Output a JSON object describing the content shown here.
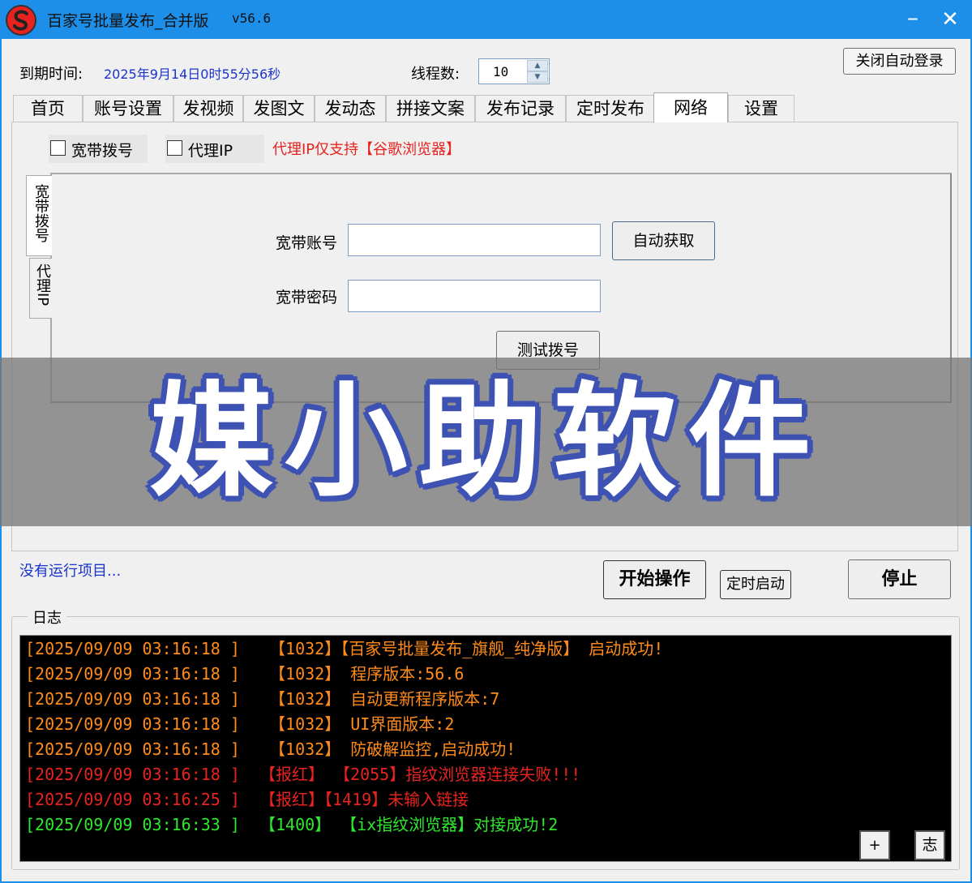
{
  "window": {
    "title": "百家号批量发布_合并版",
    "version": "v56.6",
    "minimize_label": "–",
    "close_label": "✕",
    "logo_icon": "red-s-logo-icon"
  },
  "header": {
    "expiry_label": "到期时间:",
    "expiry_value": "2025年9月14日0时55分56秒",
    "thread_label": "线程数:",
    "thread_value": "10",
    "spin_up": "▲",
    "spin_down": "▼",
    "close_autologin_label": "关闭自动登录"
  },
  "tabs": [
    "首页",
    "账号设置",
    "发视频",
    "发图文",
    "发动态",
    "拼接文案",
    "发布记录",
    "定时发布",
    "网络",
    "设置"
  ],
  "active_tab": "网络",
  "network": {
    "broadband_dial_label": "宽带拨号",
    "proxy_ip_label": "代理IP",
    "proxy_note": "代理IP仅支持【谷歌浏览器】",
    "vertical_tabs": [
      "宽带拨号",
      "代理IP"
    ],
    "account_label": "宽带账号",
    "password_label": "宽带密码",
    "auto_fetch_label": "自动获取",
    "test_dial_label": "测试拨号"
  },
  "banner_text": "媒小助软件",
  "status": {
    "text": "没有运行项目...",
    "start_label": "开始操作",
    "timer_label": "定时启动",
    "stop_label": "停止"
  },
  "log": {
    "legend": "日志",
    "lines": [
      {
        "text": "[2025/09/09 03:16:18 ]   【1032】【百家号批量发布_旗舰_纯净版】 启动成功!",
        "color": "#ff8c1a"
      },
      {
        "text": "[2025/09/09 03:16:18 ]   【1032】 程序版本:56.6",
        "color": "#ff8c1a"
      },
      {
        "text": "[2025/09/09 03:16:18 ]   【1032】 自动更新程序版本:7",
        "color": "#ff8c1a"
      },
      {
        "text": "[2025/09/09 03:16:18 ]   【1032】 UI界面版本:2",
        "color": "#ff8c1a"
      },
      {
        "text": "[2025/09/09 03:16:18 ]   【1032】 防破解监控,启动成功!",
        "color": "#ff8c1a"
      },
      {
        "text": "[2025/09/09 03:16:18 ]  【报红】 【2055】指纹浏览器连接失败!!!",
        "color": "#e8231f"
      },
      {
        "text": "[2025/09/09 03:16:25 ]  【报红】【1419】未输入链接",
        "color": "#e8231f"
      },
      {
        "text": "[2025/09/09 03:16:33 ]  【1400】 【ix指纹浏览器】对接成功!2",
        "color": "#2ee82e"
      }
    ],
    "plus_label": "+",
    "zhi_label": "志"
  }
}
